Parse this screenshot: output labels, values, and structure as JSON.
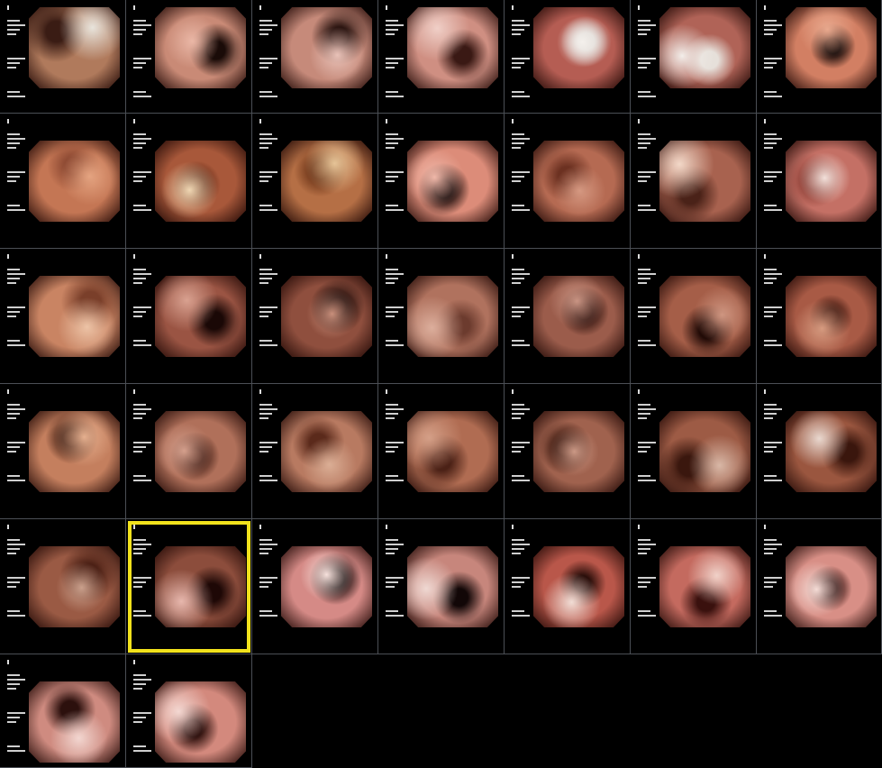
{
  "grid": {
    "columns": 7,
    "selected_index": 29,
    "thumbnails": [
      {
        "icon": "endoscopy-thumbnail",
        "base": "#b07a5c",
        "lumen": "#3a1c14",
        "highlight": "#e8e4dc"
      },
      {
        "icon": "endoscopy-thumbnail",
        "base": "#c98a76",
        "lumen": "#1a0b08",
        "highlight": "#eab7a6"
      },
      {
        "icon": "endoscopy-thumbnail",
        "base": "#c68a7a",
        "lumen": "#2a1410",
        "highlight": "#e9c2b8"
      },
      {
        "icon": "endoscopy-thumbnail",
        "base": "#cf8f82",
        "lumen": "#3a1914",
        "highlight": "#f0cfc7"
      },
      {
        "icon": "endoscopy-thumbnail",
        "base": "#b55d53",
        "lumen": "#d9d4d0",
        "highlight": "#f4f0ec"
      },
      {
        "icon": "endoscopy-thumbnail",
        "base": "#b06357",
        "lumen": "#e6e0da",
        "highlight": "#f3eeea"
      },
      {
        "icon": "endoscopy-thumbnail",
        "base": "#d27f63",
        "lumen": "#0a0303",
        "highlight": "#e9a98e"
      },
      {
        "icon": "endoscopy-thumbnail",
        "base": "#c47654",
        "lumen": "#8e4a33",
        "highlight": "#e5a481"
      },
      {
        "icon": "endoscopy-thumbnail",
        "base": "#a8583a",
        "lumen": "#5a2413",
        "highlight": "#f0d7b3"
      },
      {
        "icon": "endoscopy-thumbnail",
        "base": "#b56f45",
        "lumen": "#6b3317",
        "highlight": "#e6c497"
      },
      {
        "icon": "endoscopy-thumbnail",
        "base": "#dc8c79",
        "lumen": "#0b0202",
        "highlight": "#f0b8a9"
      },
      {
        "icon": "endoscopy-thumbnail",
        "base": "#b56a52",
        "lumen": "#6c3121",
        "highlight": "#d69982"
      },
      {
        "icon": "endoscopy-thumbnail",
        "base": "#a8624f",
        "lumen": "#4a2218",
        "highlight": "#f2d8c8"
      },
      {
        "icon": "endoscopy-thumbnail",
        "base": "#c47065",
        "lumen": "#8b3e35",
        "highlight": "#f2e0da"
      },
      {
        "icon": "endoscopy-thumbnail",
        "base": "#c98463",
        "lumen": "#7a3f2a",
        "highlight": "#edc3a6"
      },
      {
        "icon": "endoscopy-thumbnail",
        "base": "#9a5443",
        "lumen": "#1a0806",
        "highlight": "#d9a190"
      },
      {
        "icon": "endoscopy-thumbnail",
        "base": "#8f4f3e",
        "lumen": "#140605",
        "highlight": "#c98f7b"
      },
      {
        "icon": "endoscopy-thumbnail",
        "base": "#b0725e",
        "lumen": "#6c3b2e",
        "highlight": "#dcae9c"
      },
      {
        "icon": "endoscopy-thumbnail",
        "base": "#9b5c4b",
        "lumen": "#2a0f0b",
        "highlight": "#c99483"
      },
      {
        "icon": "endoscopy-thumbnail",
        "base": "#a55e48",
        "lumen": "#220b07",
        "highlight": "#cf9681"
      },
      {
        "icon": "endoscopy-thumbnail",
        "base": "#a85a45",
        "lumen": "#3c160e",
        "highlight": "#d79b80"
      },
      {
        "icon": "endoscopy-thumbnail",
        "base": "#c47f5e",
        "lumen": "#3a1a10",
        "highlight": "#e6b08f"
      },
      {
        "icon": "endoscopy-thumbnail",
        "base": "#b0705a",
        "lumen": "#3d1a12",
        "highlight": "#d5a08d"
      },
      {
        "icon": "endoscopy-thumbnail",
        "base": "#b87a61",
        "lumen": "#5b2a1b",
        "highlight": "#dbae95"
      },
      {
        "icon": "endoscopy-thumbnail",
        "base": "#b06c52",
        "lumen": "#4b2116",
        "highlight": "#d49f87"
      },
      {
        "icon": "endoscopy-thumbnail",
        "base": "#a0624e",
        "lumen": "#3b1910",
        "highlight": "#cc9986"
      },
      {
        "icon": "endoscopy-thumbnail",
        "base": "#9d5b45",
        "lumen": "#3a170e",
        "highlight": "#d8b7a6"
      },
      {
        "icon": "endoscopy-thumbnail",
        "base": "#9a563f",
        "lumen": "#3a160d",
        "highlight": "#e9d8cf"
      },
      {
        "icon": "endoscopy-thumbnail",
        "base": "#9a5a44",
        "lumen": "#4a1f14",
        "highlight": "#caa08c"
      },
      {
        "icon": "endoscopy-thumbnail",
        "base": "#8c4d3c",
        "lumen": "#1e0806",
        "highlight": "#e7b7ad"
      },
      {
        "icon": "endoscopy-thumbnail",
        "base": "#d58a86",
        "lumen": "#0c0404",
        "highlight": "#f7e1dc"
      },
      {
        "icon": "endoscopy-thumbnail",
        "base": "#c7867c",
        "lumen": "#120707",
        "highlight": "#efd8d2"
      },
      {
        "icon": "endoscopy-thumbnail",
        "base": "#b9574a",
        "lumen": "#2a0e0a",
        "highlight": "#f1ddd5"
      },
      {
        "icon": "endoscopy-thumbnail",
        "base": "#c46a5f",
        "lumen": "#3a110e",
        "highlight": "#f0d1c8"
      },
      {
        "icon": "endoscopy-thumbnail",
        "base": "#d88f86",
        "lumen": "#2a0b09",
        "highlight": "#f5dcd6"
      },
      {
        "icon": "endoscopy-thumbnail",
        "base": "#cf8b80",
        "lumen": "#2c100d",
        "highlight": "#f2d6d0"
      },
      {
        "icon": "endoscopy-thumbnail",
        "base": "#d3897d",
        "lumen": "#2a0d0a",
        "highlight": "#f4d8d2"
      }
    ]
  }
}
